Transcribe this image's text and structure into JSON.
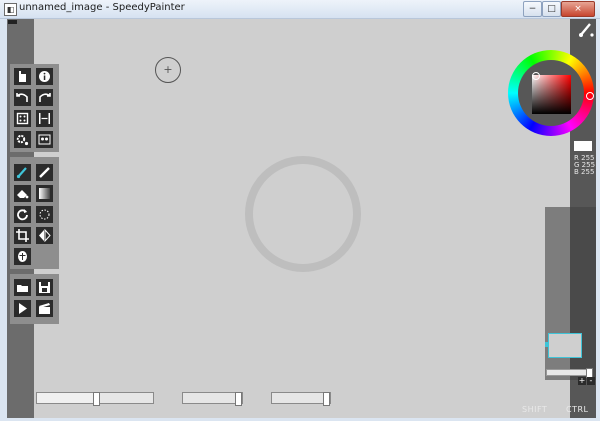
{
  "window": {
    "title": "unnamed_image - SpeedyPainter",
    "controls": [
      "−",
      "□",
      "×"
    ]
  },
  "tools": {
    "group1": [
      {
        "name": "new-file-icon"
      },
      {
        "name": "info-icon"
      },
      {
        "name": "undo-icon"
      },
      {
        "name": "redo-icon"
      },
      {
        "name": "random-icon"
      },
      {
        "name": "resize-icon"
      },
      {
        "name": "settings-icon"
      },
      {
        "name": "canvas-fit-icon"
      }
    ],
    "group2": [
      {
        "name": "brush-icon",
        "active": true
      },
      {
        "name": "pen-icon"
      },
      {
        "name": "eraser-icon"
      },
      {
        "name": "gradient-icon"
      },
      {
        "name": "rotate-icon"
      },
      {
        "name": "lasso-icon"
      },
      {
        "name": "crop-icon"
      },
      {
        "name": "flip-icon"
      },
      {
        "name": "mask-icon"
      }
    ],
    "group3": [
      {
        "name": "open-folder-icon"
      },
      {
        "name": "save-icon"
      },
      {
        "name": "play-icon"
      },
      {
        "name": "record-icon"
      }
    ]
  },
  "color": {
    "hex": "#ffffff",
    "r_label": "R",
    "g_label": "G",
    "b_label": "B",
    "r": "255",
    "g": "255",
    "b": "255",
    "accent": "#3fc4d8"
  },
  "cursor": {
    "symbol": "+"
  },
  "layers": {
    "add": "+",
    "remove": "-",
    "opacity": 0.9
  },
  "sliders": [
    {
      "name": "brush-size-slider",
      "value": 0.5
    },
    {
      "name": "opacity-slider",
      "value": 0.9
    },
    {
      "name": "flow-slider",
      "value": 0.9
    }
  ],
  "hints": {
    "shift": "SHIFT",
    "ctrl": "CTRL"
  }
}
